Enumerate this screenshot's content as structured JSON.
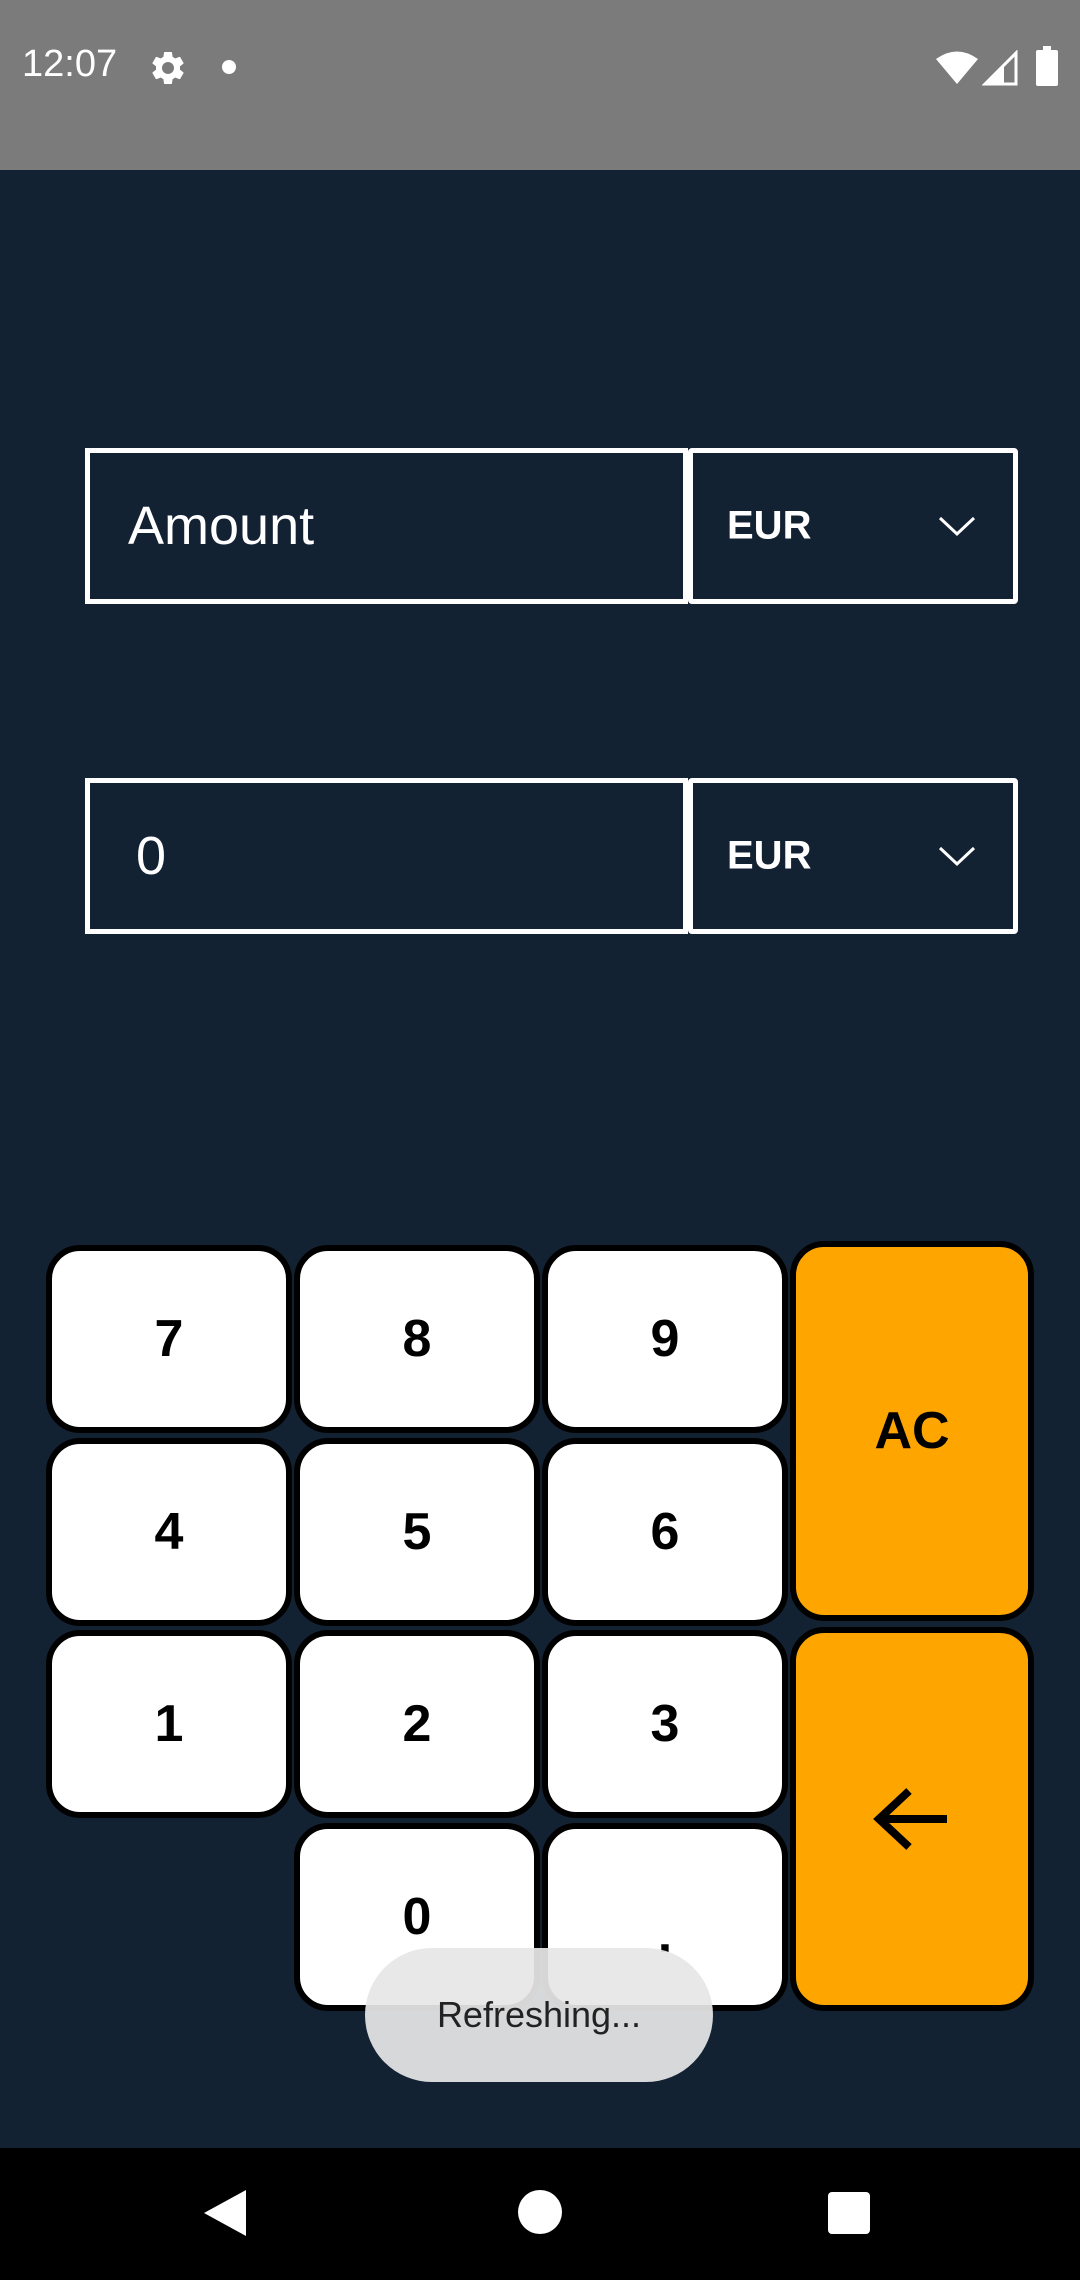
{
  "status_bar": {
    "time": "12:07",
    "icons": [
      "gear-icon",
      "notification-dot-icon",
      "wifi-icon",
      "signal-icon",
      "battery-icon"
    ]
  },
  "converter": {
    "from": {
      "placeholder": "Amount",
      "currency": "EUR"
    },
    "to": {
      "value": "0",
      "currency": "EUR"
    }
  },
  "keypad": {
    "keys": {
      "seven": "7",
      "eight": "8",
      "nine": "9",
      "four": "4",
      "five": "5",
      "six": "6",
      "one": "1",
      "two": "2",
      "three": "3",
      "zero": "0",
      "decimal": ".",
      "clear": "AC"
    },
    "backspace_icon": "arrow-left-icon"
  },
  "toast": {
    "message": "Refreshing..."
  },
  "colors": {
    "background": "#132233",
    "status_bar": "#7b7b7b",
    "key_face": "#ffffff",
    "key_accent": "#ffa500",
    "nav_bar": "#000000"
  },
  "nav_bar": {
    "icons": [
      "back-icon",
      "home-icon",
      "recents-icon"
    ]
  }
}
